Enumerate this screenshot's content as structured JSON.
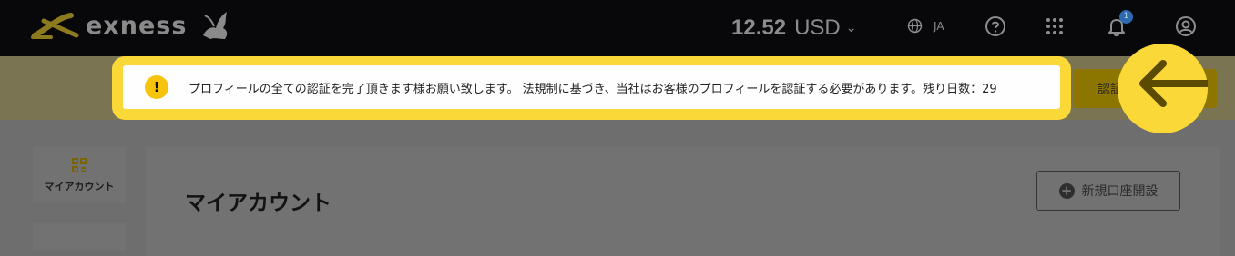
{
  "header": {
    "brand": "exness",
    "balance_amount": "12.52",
    "balance_currency": "USD",
    "language": "JA",
    "notification_count": "1",
    "icons": [
      "globe-icon",
      "help-icon",
      "apps-grid-icon",
      "bell-icon",
      "user-icon"
    ]
  },
  "notice": {
    "text": "プロフィールの全ての認証を完了頂きます様お願い致します。 法規制に基づき、当社はお客様のプロフィールを認証する必要があります。残り日数：29",
    "icon": "exclamation-icon"
  },
  "verify_button": {
    "label": "認証を完了させる"
  },
  "sidebar": {
    "items": [
      {
        "label": "マイアカウント",
        "icon": "dashboard-icon"
      }
    ]
  },
  "main": {
    "title": "マイアカウント",
    "new_account_label": "新規口座開設"
  },
  "colors": {
    "brand_yellow": "#f9d838",
    "topbar": "#08080a",
    "overlay": "#6e6e6e"
  }
}
